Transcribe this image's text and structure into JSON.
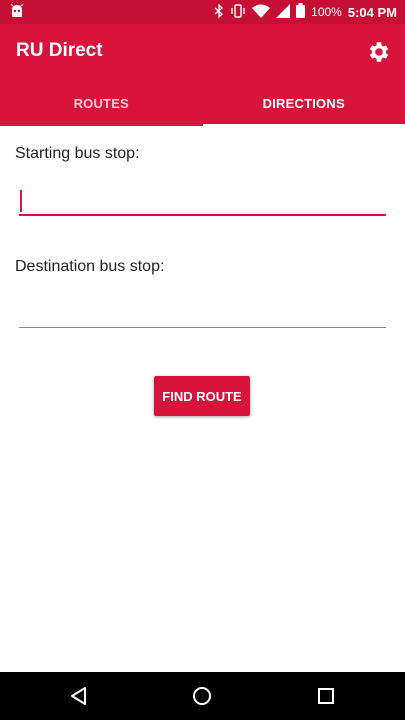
{
  "status_bar": {
    "battery": "100%",
    "time": "5:04 PM",
    "icons": [
      "android-debug-icon",
      "bluetooth-icon",
      "vibrate-icon",
      "wifi-icon",
      "signal-icon",
      "battery-icon"
    ]
  },
  "app": {
    "title": "RU Direct",
    "colors": {
      "primary": "#d7143c",
      "status": "#c70f35"
    }
  },
  "tabs": [
    {
      "label": "ROUTES",
      "active": false
    },
    {
      "label": "DIRECTIONS",
      "active": true
    }
  ],
  "form": {
    "start_label": "Starting bus stop:",
    "start_value": "",
    "destination_label": "Destination bus stop:",
    "destination_value": "",
    "find_button": "FIND ROUTE"
  },
  "nav": [
    "back-icon",
    "home-icon",
    "recents-icon"
  ]
}
